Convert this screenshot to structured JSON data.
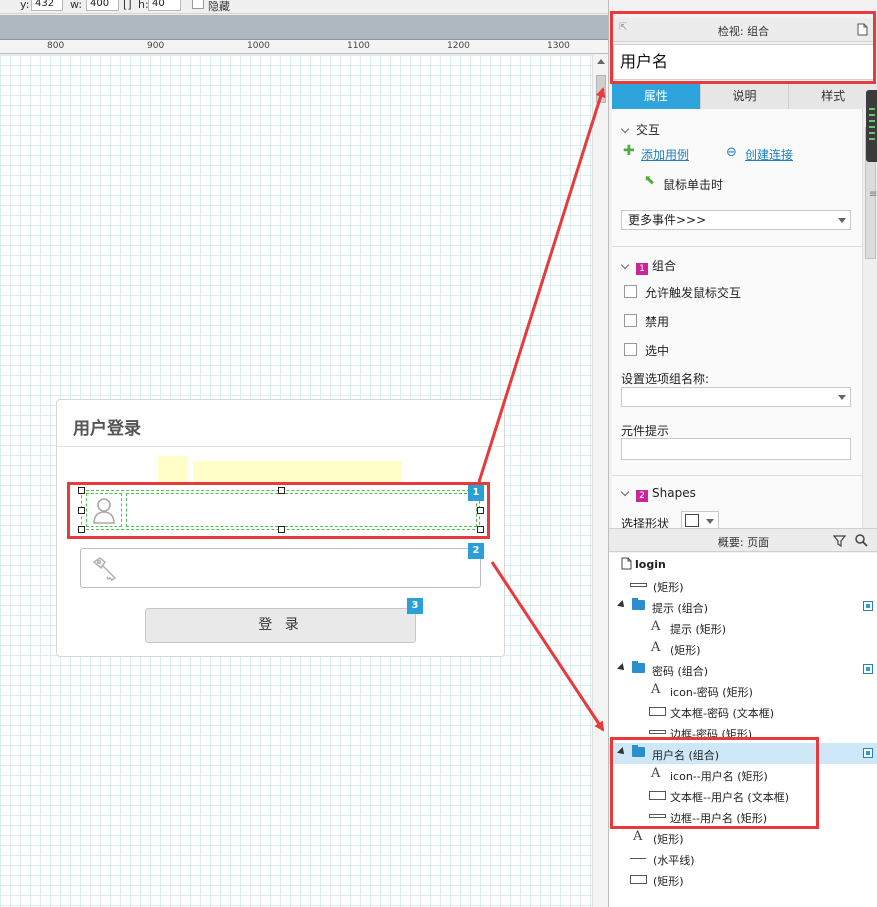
{
  "toolbar": {
    "y_label": "y:",
    "y_value": "432",
    "w_label": "w:",
    "w_value": "400",
    "h_label": "h:",
    "h_value": "40",
    "hidden_label": "隐藏"
  },
  "ruler": {
    "ticks": [
      "800",
      "900",
      "1000",
      "1100",
      "1200",
      "1300"
    ]
  },
  "card": {
    "title": "用户登录",
    "login_button": "登 录",
    "badges": [
      "1",
      "2",
      "3"
    ]
  },
  "inspector": {
    "header": "检视: 组合",
    "name": "用户名",
    "tabs": [
      "属性",
      "说明",
      "样式"
    ],
    "interaction_title": "交互",
    "add_case": "添加用例",
    "create_link": "创建连接",
    "event_on_click": "鼠标单击时",
    "more_events": "更多事件>>>",
    "group_badge": "1",
    "group_title": "组合",
    "checkbox_allow": "允许触发鼠标交互",
    "checkbox_disabled": "禁用",
    "checkbox_selected": "选中",
    "option_group_label": "设置选项组名称:",
    "tooltip_label": "元件提示",
    "shapes_badge": "2",
    "shapes_title": "Shapes",
    "select_shape": "选择形状"
  },
  "outline": {
    "header": "概要: 页面",
    "rows": [
      "login",
      "(矩形)",
      "提示 (组合)",
      "提示 (矩形)",
      "(矩形)",
      "密码 (组合)",
      "icon-密码 (矩形)",
      "文本框-密码 (文本框)",
      "边框-密码 (矩形)",
      "用户名 (组合)",
      "icon--用户名 (矩形)",
      "文本框--用户名 (文本框)",
      "边框--用户名 (矩形)",
      "(矩形)",
      "(水平线)",
      "(矩形)"
    ]
  },
  "colors": {
    "accent": "#2fa3dc",
    "annotation": "#e83a3a",
    "selection": "#4ec04e",
    "badge": "#c9269a"
  }
}
